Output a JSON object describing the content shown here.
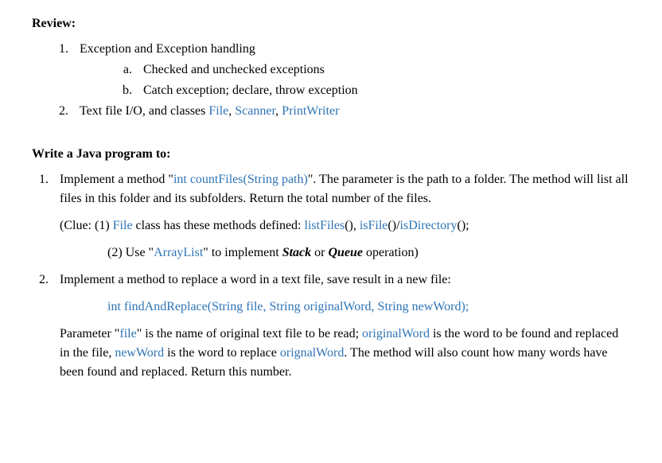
{
  "review": {
    "heading": "Review:",
    "items": [
      {
        "text": "Exception and Exception handling",
        "sub": [
          "Checked and unchecked exceptions",
          "Catch exception; declare, throw exception"
        ]
      },
      {
        "prefix": "Text file I/O, and classes ",
        "link1": "File",
        "sep1": ", ",
        "link2": "Scanner",
        "sep2": ", ",
        "link3": "PrintWriter"
      }
    ]
  },
  "write": {
    "heading": "Write a Java program to:",
    "items": [
      {
        "p1_a": "Implement a method \"",
        "p1_method": "int countFiles(String path)",
        "p1_b": "\". The parameter is the path to a folder. The method will list all files in this folder and its subfolders. Return the total number of the files.",
        "clue1_a": "(Clue: (1) ",
        "clue1_file": "File",
        "clue1_b": " class has these methods defined: ",
        "clue1_m1": "listFiles",
        "clue1_c": "(), ",
        "clue1_m2": "isFile",
        "clue1_d": "()/",
        "clue1_m3": "isDirectory",
        "clue1_e": "();",
        "clue2_a": "(2) Use \"",
        "clue2_al": "ArrayList",
        "clue2_b": "\" to implement ",
        "clue2_stack": "Stack",
        "clue2_c": " or ",
        "clue2_queue": "Queue",
        "clue2_d": " operation)"
      },
      {
        "p1": "Implement a method to replace a word in a text file, save result in a new file:",
        "sig": "int findAndReplace(String file, String originalWord, String newWord);",
        "p2_a": "Parameter \"",
        "p2_file": "file",
        "p2_b": "\" is the name of original text file to be read; ",
        "p2_ow": "originalWord",
        "p2_c": " is the word to be found and replaced in the file, ",
        "p2_nw": "newWord",
        "p2_d": " is the word to replace ",
        "p2_ogw": "orignalWord",
        "p2_e": ". The method will also count how many words have been found and replaced. Return this number."
      }
    ]
  }
}
